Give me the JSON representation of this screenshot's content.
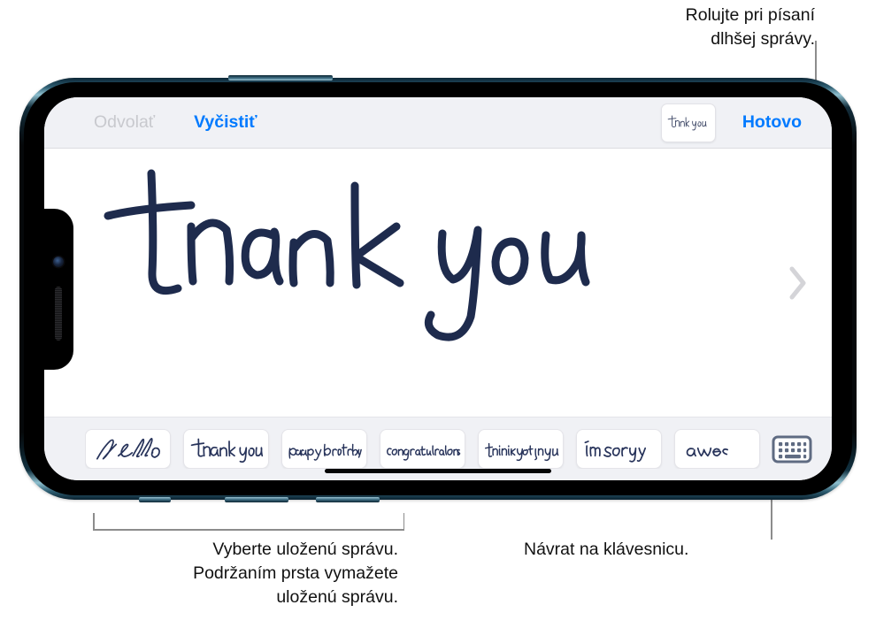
{
  "callouts": {
    "top_right": "Rolujte pri písaní\ndlhšej správy.",
    "bottom_left": "Vyberte uloženú správu.\nPodržaním prsta vymažete\nuloženú správu.",
    "bottom_right": "Návrat na klávesnicu."
  },
  "toolbar": {
    "undo_label": "Odvolať",
    "clear_label": "Vyčistiť",
    "done_label": "Hotovo",
    "thumbnail_text": "thank you"
  },
  "canvas": {
    "handwriting_text": "thank you",
    "scroll_icon": "chevron-right-icon"
  },
  "suggestions": {
    "items": [
      {
        "text": "hello"
      },
      {
        "text": "thank you"
      },
      {
        "text": "happy birthday"
      },
      {
        "text": "congratulations"
      },
      {
        "text": "thinking of you"
      },
      {
        "text": "I'm sorry"
      },
      {
        "text": "awesome"
      }
    ],
    "keyboard_button_icon": "keyboard-icon"
  },
  "colors": {
    "accent_blue": "#007aff",
    "disabled_gray": "#c8c9ce",
    "ink_navy": "#1e2b4d",
    "chrome_gray": "#f0f1f5",
    "leader_line": "#8c8c8c"
  }
}
